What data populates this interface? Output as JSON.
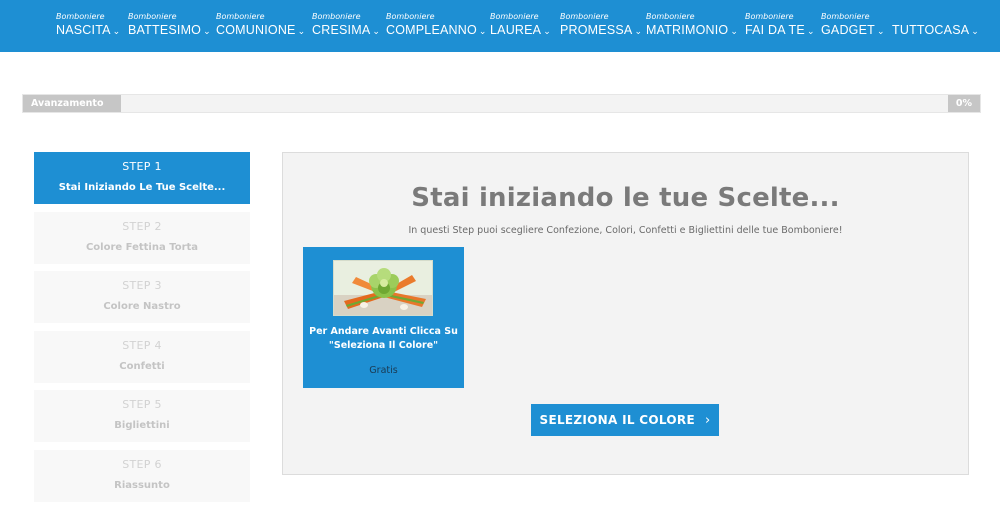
{
  "nav": {
    "items": [
      {
        "sup": "Bomboniere",
        "label": "NASCITA"
      },
      {
        "sup": "Bomboniere",
        "label": "BATTESIMO"
      },
      {
        "sup": "Bomboniere",
        "label": "COMUNIONE"
      },
      {
        "sup": "Bomboniere",
        "label": "CRESIMA"
      },
      {
        "sup": "Bomboniere",
        "label": "COMPLEANNO"
      },
      {
        "sup": "Bomboniere",
        "label": "LAUREA"
      },
      {
        "sup": "Bomboniere",
        "label": "PROMESSA"
      },
      {
        "sup": "Bomboniere",
        "label": "MATRIMONIO"
      },
      {
        "sup": "Bomboniere",
        "label": "FAI DA TE"
      },
      {
        "sup": "Bomboniere",
        "label": "GADGET"
      },
      {
        "sup": "",
        "label": "TUTTOCASA"
      }
    ],
    "chevron": "⌄"
  },
  "progress": {
    "label": "Avanzamento",
    "percent_text": "0%",
    "value": 0
  },
  "steps": [
    {
      "num": "STEP 1",
      "name": "Stai Iniziando Le Tue Scelte...",
      "active": true
    },
    {
      "num": "STEP 2",
      "name": "Colore Fettina Torta",
      "active": false
    },
    {
      "num": "STEP 3",
      "name": "Colore Nastro",
      "active": false
    },
    {
      "num": "STEP 4",
      "name": "Confetti",
      "active": false
    },
    {
      "num": "STEP 5",
      "name": "Bigliettini",
      "active": false
    },
    {
      "num": "STEP 6",
      "name": "Riassunto",
      "active": false
    }
  ],
  "main": {
    "title": "Stai iniziando le tue Scelte...",
    "subtitle": "In questi Step puoi scegliere Confezione, Colori, Confetti e Bigliettini delle tue Bomboniere!",
    "card": {
      "title": "Per Andare Avanti Clicca Su \"Seleziona Il Colore\"",
      "price": "Gratis",
      "image": "bomboniera-flower-image"
    },
    "select_button": "SELEZIONA IL COLORE",
    "select_arrow": "›"
  },
  "colors": {
    "brand_blue": "#1e8fd3",
    "panel_bg": "#f3f3f3",
    "inactive_step": "#f8f8f8",
    "progress_fill": "#c6c6c6"
  }
}
